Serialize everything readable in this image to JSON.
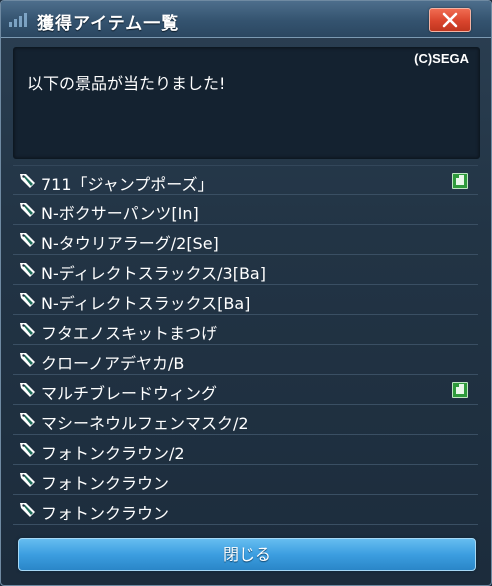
{
  "window": {
    "title": "獲得アイテム一覧",
    "close_icon": "x-icon"
  },
  "message": {
    "copyright": "(C)SEGA",
    "text": "以下の景品が当たりました!"
  },
  "items": [
    {
      "label": "711「ジャンプポーズ」",
      "icon": "tag-icon",
      "badge": true
    },
    {
      "label": "N-ボクサーパンツ[In]",
      "icon": "tag-icon",
      "badge": false
    },
    {
      "label": "N-タウリアラーグ/2[Se]",
      "icon": "tag-icon",
      "badge": false
    },
    {
      "label": "N-ディレクトスラックス/3[Ba]",
      "icon": "tag-icon",
      "badge": false
    },
    {
      "label": "N-ディレクトスラックス[Ba]",
      "icon": "tag-icon",
      "badge": false
    },
    {
      "label": "フタエノスキットまつげ",
      "icon": "tag-icon",
      "badge": false
    },
    {
      "label": "クローノアデヤカ/B",
      "icon": "tag-icon",
      "badge": false
    },
    {
      "label": "マルチブレードウィング",
      "icon": "tag-icon",
      "badge": true
    },
    {
      "label": "マシーネウルフェンマスク/2",
      "icon": "tag-icon",
      "badge": false
    },
    {
      "label": "フォトンクラウン/2",
      "icon": "tag-icon",
      "badge": false
    },
    {
      "label": "フォトンクラウン",
      "icon": "tag-icon",
      "badge": false
    },
    {
      "label": "フォトンクラウン",
      "icon": "tag-icon",
      "badge": false
    }
  ],
  "footer": {
    "close_label": "閉じる"
  },
  "colors": {
    "titlebar": "#34536f",
    "close_red": "#d9452d",
    "button_blue": "#3c9ee0",
    "badge_green": "#2f9a3c"
  }
}
